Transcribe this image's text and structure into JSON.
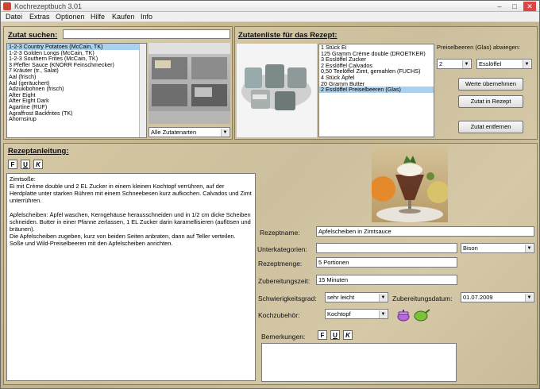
{
  "window": {
    "title": "Kochrezeptbuch 3.01",
    "minimize": "–",
    "maximize": "□",
    "close": "✕"
  },
  "menu": [
    "Datei",
    "Extras",
    "Optionen",
    "Hilfe",
    "Kaufen",
    "Info"
  ],
  "search": {
    "label": "Zutat suchen:",
    "value": "",
    "category_dropdown": "Alle Zutatenarten"
  },
  "ingredients": [
    "1-2-3 Country Potatoes (McCain, TK)",
    "1-2-3 Golden Longs (McCain, TK)",
    "1-2-3 Southern Frites (McCain, TK)",
    "3 Pfeffer Sauce (KNORR Feinschmecker)",
    "7 Kräuter (tr., Salat)",
    "Aal (frisch)",
    "Aal (geräuchert)",
    "Adzukibohnen (frisch)",
    "After Eight",
    "After Eight Dark",
    "Agartine (RUF)",
    "Agraffrost Backfrites (TK)",
    "Ahornsirup"
  ],
  "recipe_ingredients": {
    "label": "Zutatenliste für das Rezept:",
    "items": [
      "1 Stück Ei",
      "125 Gramm Crème double (DROETKER)",
      "3 Esslöffel Zucker",
      "2 Esslöffel Calvados",
      "0,50 Teelöffel Zimt, gemahlen (FUCHS)",
      "4 Stück Äpfel",
      "20 Gramm Butter",
      "2 Esslöffel Preiselbeeren (Glas)"
    ],
    "selected_index": 7
  },
  "weigh": {
    "label": "Preiselbeeren (Glas) abwiegen:",
    "amount": "2",
    "unit": "Esslöffel",
    "apply_button": "Werte übernehmen",
    "add_button": "Zutat in Rezept",
    "remove_button": "Zutat entfernen"
  },
  "instructions": {
    "label": "Rezeptanleitung:",
    "format_buttons": [
      "F",
      "U",
      "K"
    ],
    "text": "Zimtsoße:\nEi mit Crème double und 2 EL Zucker in einem kleinen Kochtopf verrühren, auf der Herdplatte unter starken Rühren mit einem Schneebesen kurz aufkochen. Calvados und Zimt unterrühren.\n\nApfelscheiben: Äpfel waschen, Kerngehäuse herausschneiden und in 1/2 cm dicke Scheiben schneiden. Butter in einer Pfanne zerlassen, 1 EL Zucker darin karamellisieren (auflösen und bräunen).\nDie Apfelscheiben zugeben, kurz von beiden Seiten anbraten, dann auf Teller verteilen.\nSoße und Wild-Preiselbeeren mit den Apfelscheiben anrichten."
  },
  "details": {
    "name_label": "Rezeptname:",
    "name": "Apfelscheiben in Zimtsauce",
    "subcat_label": "Unterkategorien:",
    "subcat": "",
    "subcat2": "Bison",
    "amount_label": "Rezeptmenge:",
    "amount": "5 Portionen",
    "time_label": "Zubereitungszeit:",
    "time": "15 Minuten",
    "difficulty_label": "Schwierigkeitsgrad:",
    "difficulty": "sehr leicht",
    "date_label": "Zubereitungsdatum:",
    "date": "01.07.2009",
    "tool_label": "Kochzubehör:",
    "tool": "Kochtopf",
    "notes_label": "Bemerkungen:",
    "notes": ""
  },
  "colors": {
    "accent": "#a9d1f0"
  }
}
